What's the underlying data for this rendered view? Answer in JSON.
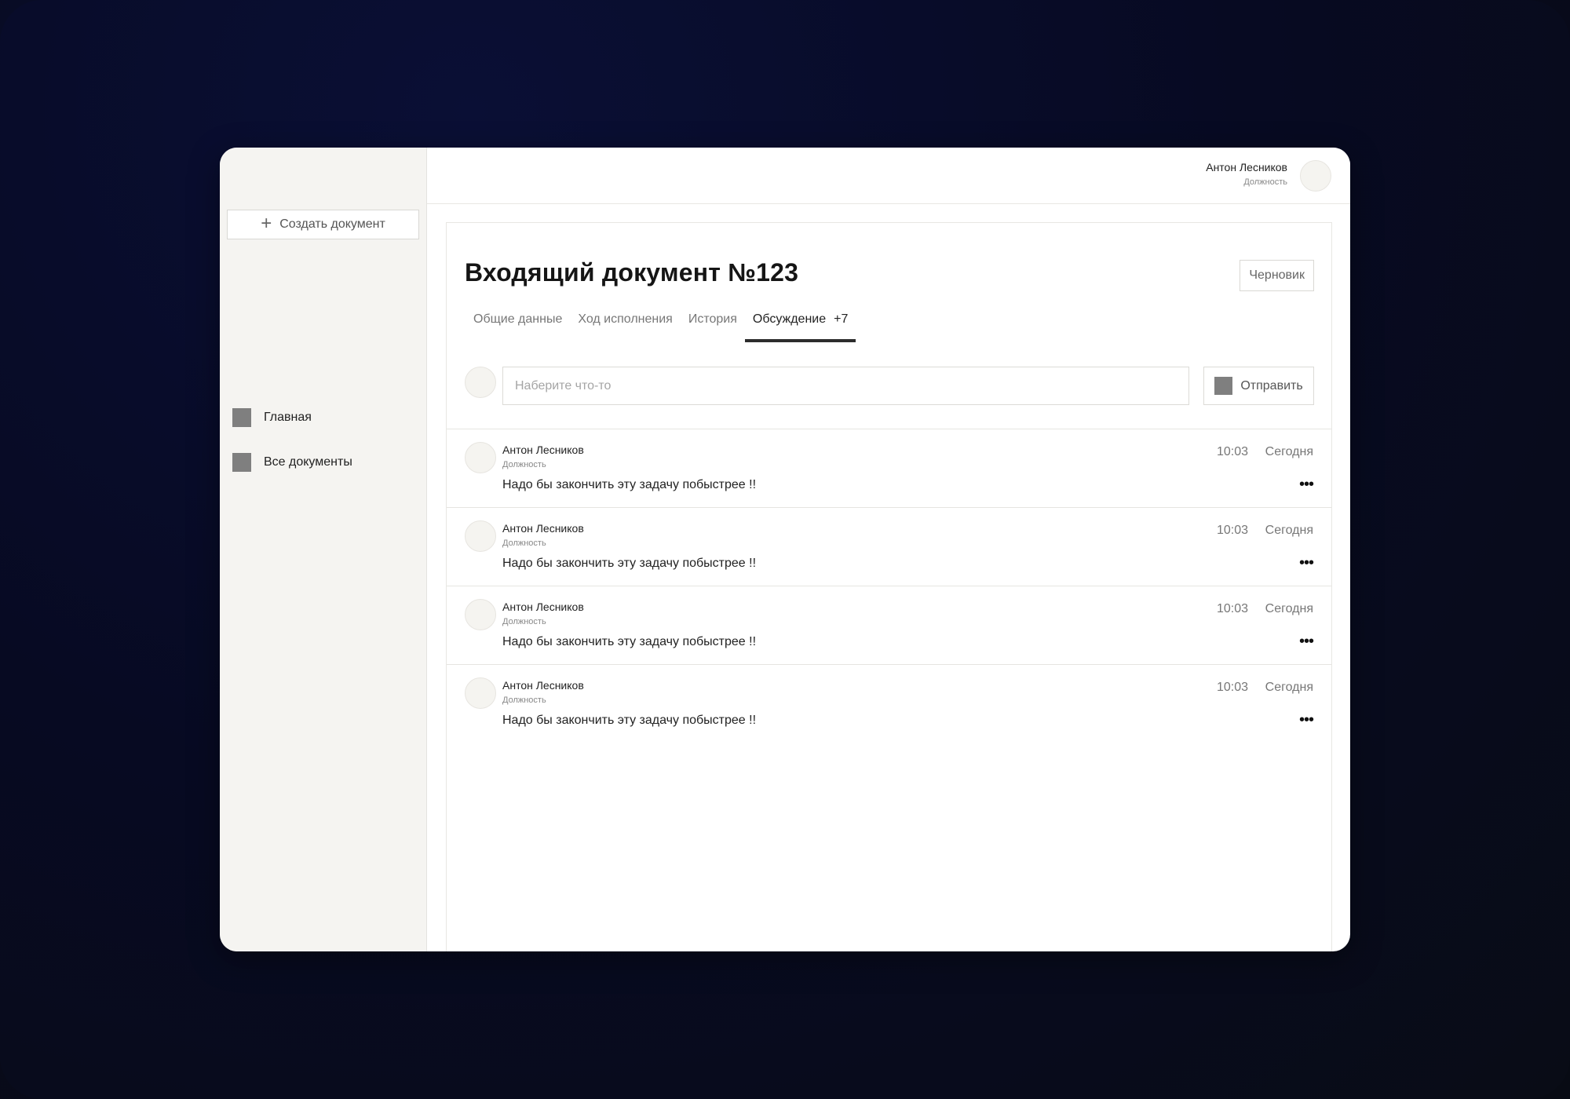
{
  "sidebar": {
    "create_button": "Создать документ",
    "items": [
      {
        "label": "Главная"
      },
      {
        "label": "Все документы"
      }
    ]
  },
  "header": {
    "user_name": "Антон Лесников",
    "user_role": "Должность"
  },
  "document": {
    "title": "Входящий документ №123",
    "status": "Черновик",
    "tabs": [
      {
        "label": "Общие данные"
      },
      {
        "label": "Ход исполнения"
      },
      {
        "label": "История"
      },
      {
        "label": "Обсуждение",
        "count": "+7",
        "active": true
      }
    ]
  },
  "composer": {
    "placeholder": "Наберите что-то",
    "send_label": "Отправить"
  },
  "comments": [
    {
      "author": "Антон Лесников",
      "role": "Должность",
      "text": "Надо бы закончить эту задачу побыстрее !!",
      "time": "10:03",
      "date": "Сегодня"
    },
    {
      "author": "Антон Лесников",
      "role": "Должность",
      "text": "Надо бы закончить эту задачу побыстрее !!",
      "time": "10:03",
      "date": "Сегодня"
    },
    {
      "author": "Антон Лесников",
      "role": "Должность",
      "text": "Надо бы закончить эту задачу побыстрее !!",
      "time": "10:03",
      "date": "Сегодня"
    },
    {
      "author": "Антон Лесников",
      "role": "Должность",
      "text": "Надо бы закончить эту задачу побыстрее !!",
      "time": "10:03",
      "date": "Сегодня"
    }
  ],
  "icons": {
    "more": "•••"
  }
}
